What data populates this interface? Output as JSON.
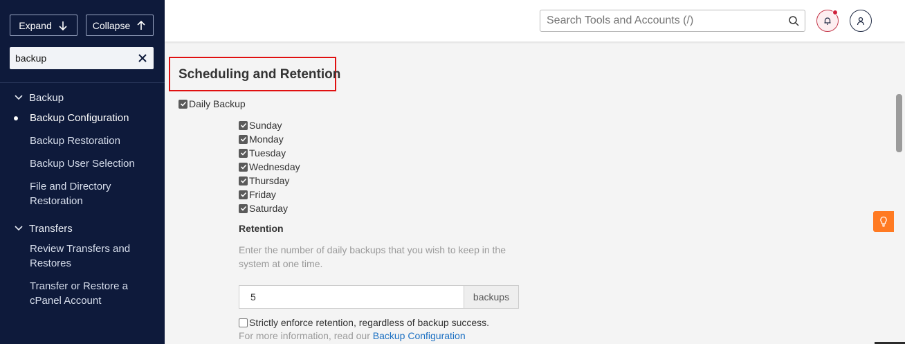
{
  "sidebar": {
    "expand_label": "Expand",
    "collapse_label": "Collapse",
    "search_value": "backup",
    "groups": [
      {
        "label": "Backup",
        "items": [
          {
            "label": "Backup Configuration",
            "active": true
          },
          {
            "label": "Backup Restoration"
          },
          {
            "label": "Backup User Selection"
          },
          {
            "label": "File and Directory Restoration"
          }
        ]
      },
      {
        "label": "Transfers",
        "items": [
          {
            "label": "Review Transfers and Restores"
          },
          {
            "label": "Transfer or Restore a cPanel Account"
          }
        ]
      }
    ]
  },
  "header": {
    "search_placeholder": "Search Tools and Accounts (/)",
    "notification_icon": "bell-icon",
    "user_icon": "user-icon"
  },
  "main": {
    "section_title": "Scheduling and Retention",
    "daily_backup_label": "Daily Backup",
    "days": [
      {
        "label": "Sunday",
        "checked": true
      },
      {
        "label": "Monday",
        "checked": true
      },
      {
        "label": "Tuesday",
        "checked": true
      },
      {
        "label": "Wednesday",
        "checked": true
      },
      {
        "label": "Thursday",
        "checked": true
      },
      {
        "label": "Friday",
        "checked": true
      },
      {
        "label": "Saturday",
        "checked": true
      }
    ],
    "retention_label": "Retention",
    "retention_help": "Enter the number of daily backups that you wish to keep in the system at one time.",
    "retention_value": "5",
    "retention_unit": "backups",
    "strict_label": "Strictly enforce retention, regardless of backup success.",
    "more_info_prefix": "For more information, read our",
    "more_info_link": "Backup Configuration"
  },
  "colors": {
    "sidebar_bg": "#0e1a3b",
    "highlight_border": "#e01010",
    "link": "#1a6fc2",
    "tip_button": "#ff7a22"
  }
}
